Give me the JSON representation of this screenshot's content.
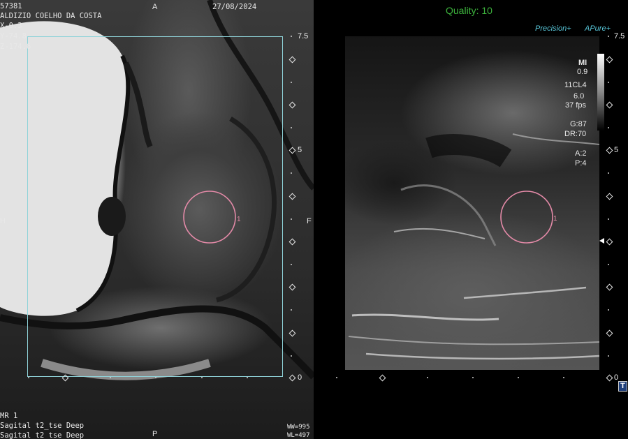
{
  "mr": {
    "patient_id": "57381",
    "patient_name": "ALDIZIO COELHO DA COSTA",
    "date": "27/08/2024",
    "coord_x": "X-0.3",
    "coord_y": "Y-74.8",
    "coord_z": "Z-174.6",
    "orientation_top": "A",
    "orientation_bottom": "P",
    "orientation_left": "H",
    "orientation_right": "F",
    "series_label": "MR 1",
    "sequence_1": "Sagital t2_tse Deep",
    "sequence_2": "Sagital t2_tse Deep",
    "window_width": "WW=995",
    "window_level": "WL=497",
    "roi_label": "1",
    "scale_top": "7.5",
    "scale_mid": "5",
    "scale_bottom": "0"
  },
  "us": {
    "quality_label": "Quality: 10",
    "precision_label": "Precision+",
    "apure_label": "APure+",
    "mi_label": "MI",
    "mi_value": "0.9",
    "probe": "11CL4",
    "frequency": "6.0",
    "fps": "37 fps",
    "gain": "G:87",
    "dynamic_range": "DR:70",
    "a_value": "A:2",
    "p_value": "P:4",
    "roi_label": "1",
    "scale_top": "7.5",
    "scale_mid": "5",
    "scale_bottom": "0",
    "corner_button": "T"
  },
  "colors": {
    "quality_green": "#3db33d",
    "roi_circle": "#e48aa8",
    "fov_box": "#8fd3d9",
    "precision_blue": "#58c6d8"
  }
}
